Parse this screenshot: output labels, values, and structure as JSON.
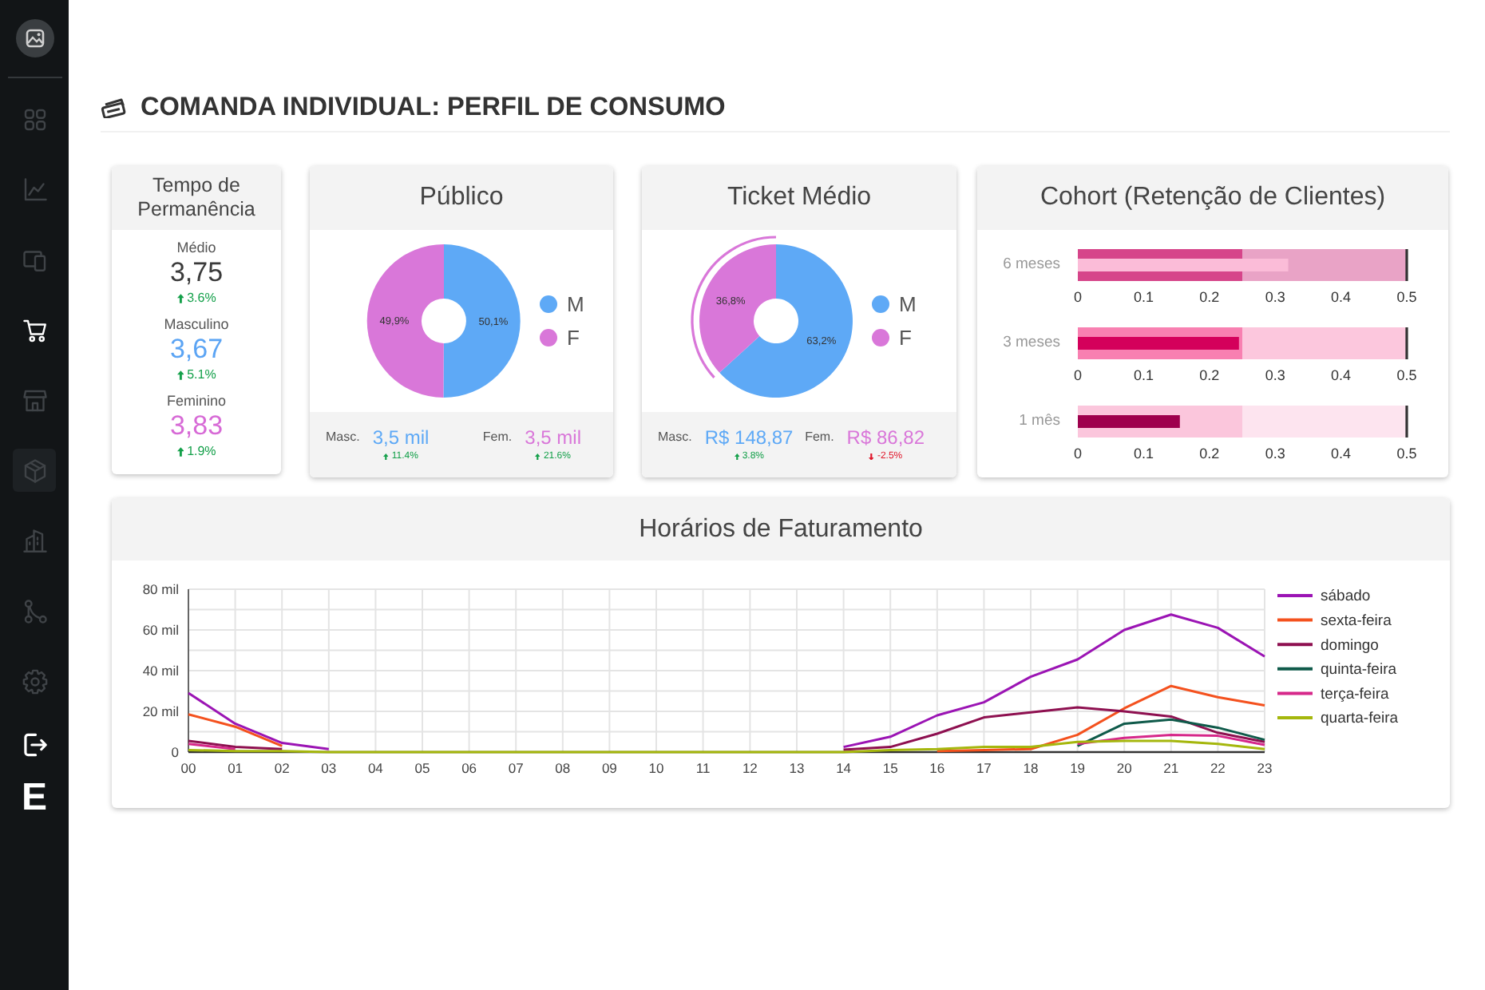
{
  "sidebar": {
    "items": [
      {
        "kind": "grid",
        "selected": false,
        "hovered": false
      },
      {
        "kind": "chart",
        "selected": false,
        "hovered": false
      },
      {
        "kind": "devices",
        "selected": false,
        "hovered": false
      },
      {
        "kind": "cart",
        "selected": true,
        "hovered": false
      },
      {
        "kind": "store",
        "selected": false,
        "hovered": false
      },
      {
        "kind": "box",
        "selected": false,
        "hovered": true
      },
      {
        "kind": "buildings",
        "selected": false,
        "hovered": false
      },
      {
        "kind": "nodes",
        "selected": false,
        "hovered": false
      },
      {
        "kind": "settings",
        "selected": false,
        "hovered": false
      }
    ],
    "logo": "E"
  },
  "page": {
    "title": "COMANDA INDIVIDUAL: PERFIL DE CONSUMO"
  },
  "tempo": {
    "title": "Tempo de Permanência",
    "rows": [
      {
        "label": "Médio",
        "value": "3,75",
        "color": "#3a3a3a",
        "up": true,
        "change": "3.6%"
      },
      {
        "label": "Masculino",
        "value": "3,67",
        "color": "#5ba4f4",
        "up": true,
        "change": "5.1%"
      },
      {
        "label": "Feminino",
        "value": "3,83",
        "color": "#d76ad6",
        "up": true,
        "change": "1.9%"
      }
    ]
  },
  "publico": {
    "title": "Público",
    "chart_data": {
      "type": "donut",
      "categories": [
        "M",
        "F"
      ],
      "values": [
        50.1,
        49.9
      ],
      "value_labels": [
        "50,1%",
        "49,9%"
      ]
    },
    "slices": [
      {
        "color": "#5ea9f6",
        "selected": false
      },
      {
        "color": "#d977d9",
        "selected": false
      }
    ],
    "footer": [
      {
        "label": "Masc.",
        "value": "3,5 mil",
        "color": "#5ea9f6",
        "up": true,
        "change": "11.4%"
      },
      {
        "label": "Fem.",
        "value": "3,5 mil",
        "color": "#d977d9",
        "up": true,
        "change": "21.6%"
      }
    ]
  },
  "ticket": {
    "title": "Ticket Médio",
    "chart_data": {
      "type": "donut",
      "categories": [
        "M",
        "F"
      ],
      "values": [
        63.2,
        36.8
      ],
      "value_labels": [
        "63,2%",
        "36,8%"
      ]
    },
    "slices": [
      {
        "color": "#5ea9f6",
        "selected": false
      },
      {
        "color": "#d977d9",
        "selected": true
      }
    ],
    "footer": [
      {
        "label": "Masc.",
        "value": "R$ 148,87",
        "color": "#5ea9f6",
        "up": true,
        "change": "3.8%"
      },
      {
        "label": "Fem.",
        "value": "R$ 86,82",
        "color": "#d977d9",
        "up": false,
        "change": "-2.5%"
      }
    ]
  },
  "cohort": {
    "title": "Cohort (Retenção de Clientes)",
    "rows": [
      {
        "chart_data": {
          "type": "bar",
          "orientation": "horizontal",
          "categories": [
            "6 meses"
          ],
          "values": [
            0.32
          ],
          "xlim": [
            0,
            0.5
          ],
          "xticks": [
            0,
            0.1,
            0.2,
            0.3,
            0.4,
            0.5
          ],
          "bands": [
            {
              "axis": "x",
              "from": 0,
              "to": 0.25
            },
            {
              "axis": "x",
              "from": 0.25,
              "to": 0.5
            }
          ],
          "ref_lines": [
            {
              "axis": "x",
              "value": 0.5
            }
          ]
        }
      },
      {
        "chart_data": {
          "type": "bar",
          "orientation": "horizontal",
          "categories": [
            "3 meses"
          ],
          "values": [
            0.245
          ],
          "xlim": [
            0,
            0.5
          ],
          "xticks": [
            0,
            0.1,
            0.2,
            0.3,
            0.4,
            0.5
          ],
          "bands": [
            {
              "axis": "x",
              "from": 0,
              "to": 0.25
            },
            {
              "axis": "x",
              "from": 0.25,
              "to": 0.5
            }
          ],
          "ref_lines": [
            {
              "axis": "x",
              "value": 0.5
            }
          ]
        }
      },
      {
        "chart_data": {
          "type": "bar",
          "orientation": "horizontal",
          "categories": [
            "1 mês"
          ],
          "values": [
            0.155
          ],
          "xlim": [
            0,
            0.5
          ],
          "xticks": [
            0,
            0.1,
            0.2,
            0.3,
            0.4,
            0.5
          ],
          "bands": [
            {
              "axis": "x",
              "from": 0,
              "to": 0.25
            },
            {
              "axis": "x",
              "from": 0.25,
              "to": 0.5
            }
          ],
          "ref_lines": [
            {
              "axis": "x",
              "value": 0.5
            }
          ]
        }
      }
    ]
  },
  "faturamento": {
    "title": "Horários de Faturamento",
    "chart_data": {
      "type": "line",
      "grid": true,
      "legend": "right",
      "categories": [
        "00",
        "01",
        "02",
        "03",
        "04",
        "05",
        "06",
        "07",
        "08",
        "09",
        "10",
        "11",
        "12",
        "13",
        "14",
        "15",
        "16",
        "17",
        "18",
        "19",
        "20",
        "21",
        "22",
        "23"
      ],
      "ylim": [
        0,
        80
      ],
      "yticks": [
        {
          "value": 0,
          "label": "0"
        },
        {
          "value": 20,
          "label": "20 mil"
        },
        {
          "value": 40,
          "label": "40 mil"
        },
        {
          "value": 60,
          "label": "60 mil"
        },
        {
          "value": 80,
          "label": "80 mil"
        }
      ],
      "series": [
        {
          "name": "sábado",
          "color": "#9b14b4",
          "values": [
            29,
            14,
            4.5,
            1.5,
            null,
            null,
            null,
            null,
            null,
            null,
            null,
            null,
            null,
            null,
            2.5,
            7.5,
            18,
            24.5,
            37,
            45.5,
            60,
            67.5,
            61,
            47
          ]
        },
        {
          "name": "sexta-feira",
          "color": "#f4511e",
          "values": [
            18.5,
            12.5,
            3,
            null,
            null,
            null,
            null,
            null,
            null,
            null,
            null,
            null,
            null,
            null,
            null,
            null,
            0.5,
            1,
            1.5,
            8.5,
            21.5,
            32.5,
            27,
            23
          ]
        },
        {
          "name": "domingo",
          "color": "#8e1050",
          "values": [
            5.5,
            2.5,
            1.5,
            null,
            null,
            null,
            null,
            null,
            null,
            null,
            null,
            null,
            null,
            null,
            1.2,
            2.5,
            9,
            17,
            19.5,
            22,
            20,
            17.5,
            9.5,
            5
          ]
        },
        {
          "name": "quinta-feira",
          "color": "#0f5a4a",
          "values": [
            null,
            null,
            null,
            null,
            null,
            null,
            null,
            null,
            null,
            null,
            null,
            null,
            null,
            null,
            null,
            null,
            null,
            null,
            null,
            3,
            14,
            16,
            12,
            6
          ]
        },
        {
          "name": "terça-feira",
          "color": "#d6288a",
          "values": [
            4,
            1.5,
            null,
            null,
            null,
            null,
            null,
            null,
            null,
            null,
            null,
            null,
            null,
            null,
            null,
            null,
            null,
            null,
            null,
            4,
            7,
            8.5,
            8,
            3.5
          ]
        },
        {
          "name": "quarta-feira",
          "color": "#a5b70d",
          "values": [
            1,
            0.5,
            0.5,
            0,
            0,
            0,
            0,
            0,
            0,
            0,
            0,
            0,
            0,
            0,
            0,
            1,
            1.5,
            2.5,
            2.5,
            5,
            5.5,
            5.5,
            4,
            1.5
          ]
        }
      ]
    }
  }
}
